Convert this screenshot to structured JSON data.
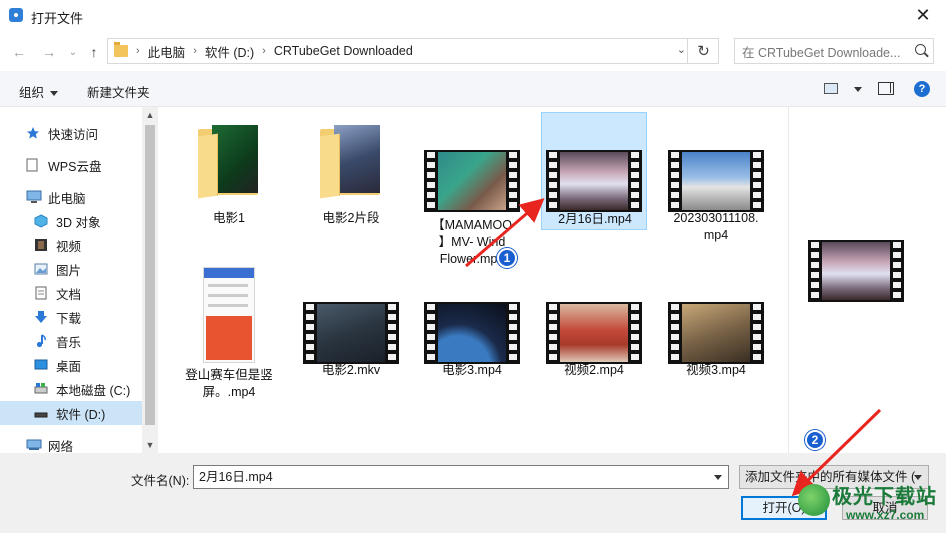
{
  "window": {
    "title": "打开文件",
    "close_glyph": "✕"
  },
  "nav": {
    "back_glyph": "←",
    "forward_glyph": "→",
    "recent_glyph": "⌄",
    "up_glyph": "↑",
    "breadcrumbs": [
      "此电脑",
      "软件 (D:)",
      "CRTubeGet Downloaded"
    ],
    "refresh_glyph": "↻",
    "search_placeholder": "在 CRTubeGet Downloade..."
  },
  "toolbar": {
    "organize": "组织",
    "new_folder": "新建文件夹",
    "help": "?"
  },
  "sidebar": {
    "items": [
      {
        "label": "快速访问",
        "icon": "star-icon"
      },
      {
        "label": "WPS云盘",
        "icon": "cloud-doc-icon"
      },
      {
        "label": "此电脑",
        "icon": "computer-icon"
      },
      {
        "label": "3D 对象",
        "icon": "cube-icon"
      },
      {
        "label": "视频",
        "icon": "video-icon"
      },
      {
        "label": "图片",
        "icon": "picture-icon"
      },
      {
        "label": "文档",
        "icon": "document-icon"
      },
      {
        "label": "下载",
        "icon": "download-icon"
      },
      {
        "label": "音乐",
        "icon": "music-icon"
      },
      {
        "label": "桌面",
        "icon": "desktop-icon"
      },
      {
        "label": "本地磁盘 (C:)",
        "icon": "drive-icon"
      },
      {
        "label": "软件 (D:)",
        "icon": "drive-icon",
        "selected": true
      },
      {
        "label": "网络",
        "icon": "network-icon"
      }
    ]
  },
  "files": [
    {
      "name": "电影1",
      "kind": "folder"
    },
    {
      "name": "电影2片段",
      "kind": "folder"
    },
    {
      "name_lines": [
        "【MAMAMOO",
        "】MV- Wind",
        "Flower.mp4"
      ],
      "kind": "video"
    },
    {
      "name": "2月16日.mp4",
      "kind": "video",
      "selected": true
    },
    {
      "name_lines": [
        "202303011108.",
        "mp4"
      ],
      "kind": "video"
    },
    {
      "name_lines": [
        "登山赛车但是竖",
        "屏。.mp4"
      ],
      "kind": "video-portrait"
    },
    {
      "name": "电影2.mkv",
      "kind": "video"
    },
    {
      "name": "电影3.mp4",
      "kind": "video"
    },
    {
      "name": "视频2.mp4",
      "kind": "video"
    },
    {
      "name": "视频3.mp4",
      "kind": "video"
    }
  ],
  "bottom": {
    "filename_label": "文件名(N):",
    "filename_value": "2月16日.mp4",
    "filetype": "添加文件夹中的所有媒体文件 (",
    "open_label": "打开(O)",
    "cancel_label": "取消"
  },
  "annotations": {
    "badge1": "1",
    "badge2": "2",
    "arrow_color": "#e8261f"
  },
  "watermark": {
    "text": "极光下载站",
    "url": "www.xz7.com"
  }
}
